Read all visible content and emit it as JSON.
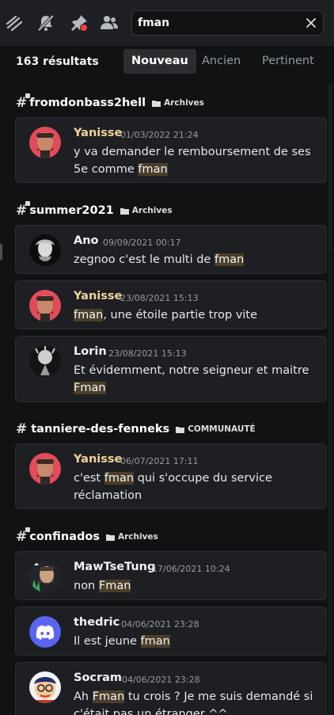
{
  "search": {
    "value": "fman"
  },
  "results_header": {
    "count": "163 résultats",
    "tabs": [
      "Nouveau",
      "Ancien",
      "Pertinent"
    ],
    "active_tab": "Nouveau"
  },
  "colors": {
    "author_gold": "#f0d59a",
    "author_white": "#f2f3f5",
    "highlight": "#4b3f2a",
    "discord_blurple": "#5865f2"
  },
  "icons": [
    "threads-icon",
    "mute-icon",
    "pinned-icon",
    "member-list-icon",
    "clear-icon",
    "channel-hash-icon",
    "folder-icon",
    "discord-logo-icon"
  ],
  "groups": [
    {
      "channel": "fromdonbass2hell",
      "category": "Archives"
    },
    {
      "channel": "summer2021",
      "category": "Archives"
    },
    {
      "channel": "tanniere-des-fenneks",
      "category": "COMMUNAUTÉ"
    },
    {
      "channel": "confinados",
      "category": "Archives"
    }
  ],
  "messages": [
    {
      "author": "Yanisse",
      "time": "01/03/2022 21:24",
      "text": [
        "y va demander le remboursement de ses 5e comme ",
        "fman",
        ""
      ]
    },
    {
      "author": "Ano",
      "time": "09/09/2021 00:17",
      "text": [
        "zegnoo c'est le multi de ",
        "fman",
        ""
      ]
    },
    {
      "author": "Yanisse",
      "time": "23/08/2021 15:13",
      "text": [
        "",
        "fman",
        ", une étoile partie trop vite"
      ]
    },
    {
      "author": "Lorin",
      "time": "23/08/2021 15:13",
      "text": [
        "Et évidemment, notre seigneur et maitre ",
        "Fman",
        ""
      ]
    },
    {
      "author": "Yanisse",
      "time": "06/07/2021 17:11",
      "text": [
        "c'est ",
        "fman",
        " qui s'occupe du service réclamation"
      ]
    },
    {
      "author": "MawTseTung",
      "time": "17/06/2021 10:24",
      "text": [
        "non ",
        "Fman",
        ""
      ]
    },
    {
      "author": "thedric",
      "time": "04/06/2021 23:28",
      "text": [
        "Il est jeune ",
        "fman",
        ""
      ]
    },
    {
      "author": "Socram",
      "time": "04/06/2021 23:28",
      "text": [
        "Ah ",
        "Fman",
        " tu crois ? Je me suis demandé si c'était pas un étranger ^^"
      ]
    }
  ]
}
